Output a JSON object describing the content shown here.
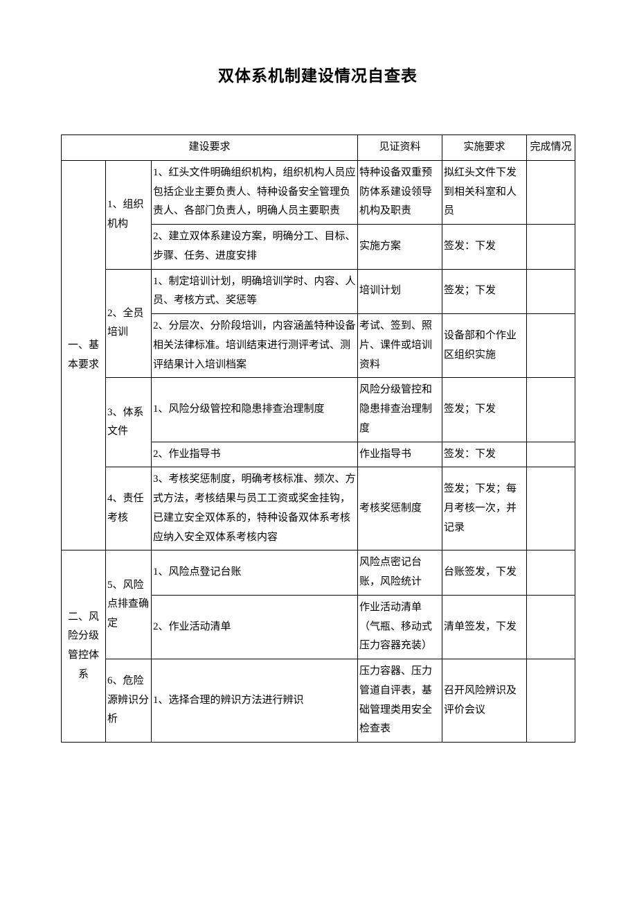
{
  "title": "双体系机制建设情况自查表",
  "headers": {
    "req": "建设要求",
    "evidence": "见证资料",
    "impl": "实施要求",
    "status": "完成情况"
  },
  "sections": [
    {
      "label": "一、基本要求",
      "groups": [
        {
          "label": "1、组织机构",
          "rows": [
            {
              "req": "1、红头文件明确组织机构，组织机构人员应包括企业主要负责人、特种设备安全管理负责人、各部门负责人，明确人员主要职责",
              "evidence": "特种设备双重预防体系建设领导机构及职责",
              "impl": "拟红头文件下发到相关科室和人员",
              "status": ""
            },
            {
              "req": "2、建立双体系建设方案，明确分工、目标、步骤、任务、进度安排",
              "evidence": "实施方案",
              "impl": "签发：下发",
              "status": ""
            }
          ]
        },
        {
          "label": "2、全员培训",
          "rows": [
            {
              "req": "1、制定培训计划，明确培训学时、内容、人员、考核方式、奖惩等",
              "evidence": "培训计划",
              "impl": "签发；下发",
              "status": ""
            },
            {
              "req": "2、分层次、分阶段培训，内容涵盖特种设备相关法律标准。培训结束进行测评考试、测评结果计入培训档案",
              "evidence": "考试、签到、照片、课件或培训资料",
              "impl": "设备部和个作业区组织实施",
              "status": ""
            }
          ]
        },
        {
          "label": "3、体系文件",
          "rows": [
            {
              "req": "1、风险分级管控和隐患排查治理制度",
              "evidence": "风险分级管控和隐患排查治理制度",
              "impl": "签发；下发",
              "status": ""
            },
            {
              "req": "2、作业指导书",
              "evidence": "作业指导书",
              "impl": "签发：下发",
              "status": ""
            }
          ]
        },
        {
          "label": "4、责任考核",
          "rows": [
            {
              "req": "3、考核奖惩制度，明确考核标准、频次、方式方法，考核结果与员工工资或奖金挂钩，已建立安全双体系的，特种设备双体系考核应纳入安全双体系考核内容",
              "evidence": "考核奖惩制度",
              "impl": "签发；下发；每月考核一次，并记录",
              "status": ""
            }
          ]
        }
      ]
    },
    {
      "label": "二、风险分级管控体系",
      "groups": [
        {
          "label": "5、风险点排查确定",
          "rows": [
            {
              "req": "1、风险点登记台账",
              "evidence": "风险点密记台账，风险统计",
              "impl": "台账签发，下发",
              "status": ""
            },
            {
              "req": "2、作业活动清单",
              "evidence": "作业活动清单（气瓶、移动式压力容器充装）",
              "impl": "清单签发，下发",
              "status": ""
            }
          ]
        },
        {
          "label": "6、危险源辨识分析",
          "rows": [
            {
              "req": "1、选择合理的辨识方法进行辨识",
              "evidence": "压力容器、压力管道自评表，基础管理类用安全检查表",
              "impl": "召开风险辨识及评价会议",
              "status": ""
            }
          ]
        }
      ]
    }
  ]
}
